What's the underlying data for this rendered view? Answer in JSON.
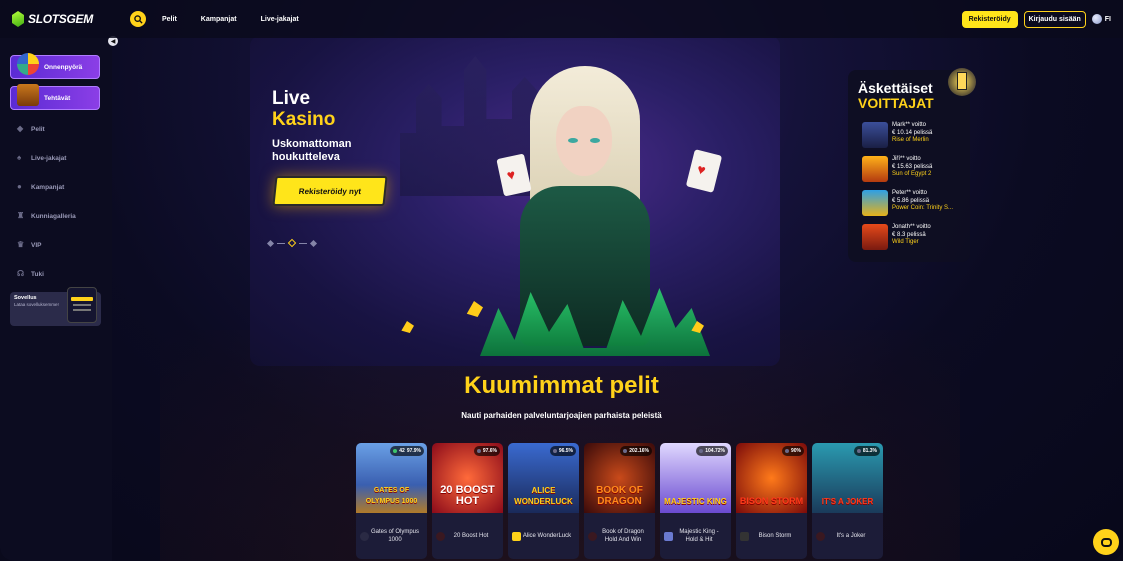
{
  "header": {
    "logo_text": "SLOTSGEM",
    "nav": [
      "Pelit",
      "Kampanjat",
      "Live-jakajat"
    ],
    "register_label": "Rekisteröidy",
    "login_label": "Kirjaudu sisään",
    "language": "FI",
    "accent_color": "#ffd21a"
  },
  "sidebar": {
    "promos": [
      "Onnenpyörä",
      "Tehtävät"
    ],
    "items": [
      {
        "label": "Pelit",
        "icon": "gem-icon"
      },
      {
        "label": "Live-jakajat",
        "icon": "cards-icon"
      },
      {
        "label": "Kampanjat",
        "icon": "gift-icon"
      },
      {
        "label": "Kunniagalleria",
        "icon": "trophy-icon"
      },
      {
        "label": "VIP",
        "icon": "crown-icon"
      },
      {
        "label": "Tuki",
        "icon": "headset-icon"
      }
    ],
    "app": {
      "title": "Sovellus",
      "subtitle": "Lataa sovelluksemme!"
    }
  },
  "hero": {
    "title_line1": "Live",
    "title_line2": "Kasino",
    "subtitle": "Uskomattoman houkutteleva",
    "cta": "Rekisteröidy nyt"
  },
  "winners": {
    "title_line1": "Äskettäiset",
    "title_line2": "voittajat",
    "entries": [
      {
        "name": "Mark** voitto",
        "amount": "€ 10.14 pelissä",
        "game": "Rise of Merlin"
      },
      {
        "name": "Jiří** voitto",
        "amount": "€ 15.63 pelissä",
        "game": "Sun of Egypt 2"
      },
      {
        "name": "Peter** voitto",
        "amount": "€ 5.86 pelissä",
        "game": "Power Coin: Trinity S..."
      },
      {
        "name": "Jonath** voitto",
        "amount": "€ 8.3 pelissä",
        "game": "Wild Tiger"
      }
    ]
  },
  "hot_games": {
    "title": "Kuumimmat pelit",
    "subtitle": "Nauti parhaiden palveluntarjoajien parhaista peleistä",
    "games": [
      {
        "name": "Gates of Olympus 1000",
        "rtp": "97.9%",
        "players": "42",
        "logo": "GATES OF OLYMPUS 1000"
      },
      {
        "name": "20 Boost Hot",
        "rtp": "97.6%",
        "logo": "20 BOOST HOT"
      },
      {
        "name": "Alice WonderLuck",
        "rtp": "96.5%",
        "logo": "ALICE WONDERLUCK"
      },
      {
        "name": "Book of Dragon Hold And Win",
        "rtp": "202.16%",
        "logo": "BOOK OF DRAGON"
      },
      {
        "name": "Majestic King - Hold & Hit",
        "rtp": "104.72%",
        "logo": "MAJESTIC KING"
      },
      {
        "name": "Bison Storm",
        "rtp": "90%",
        "logo": "BISON STORM"
      },
      {
        "name": "It's a Joker",
        "rtp": "81.3%",
        "logo": "IT'S A JOKER"
      }
    ]
  }
}
